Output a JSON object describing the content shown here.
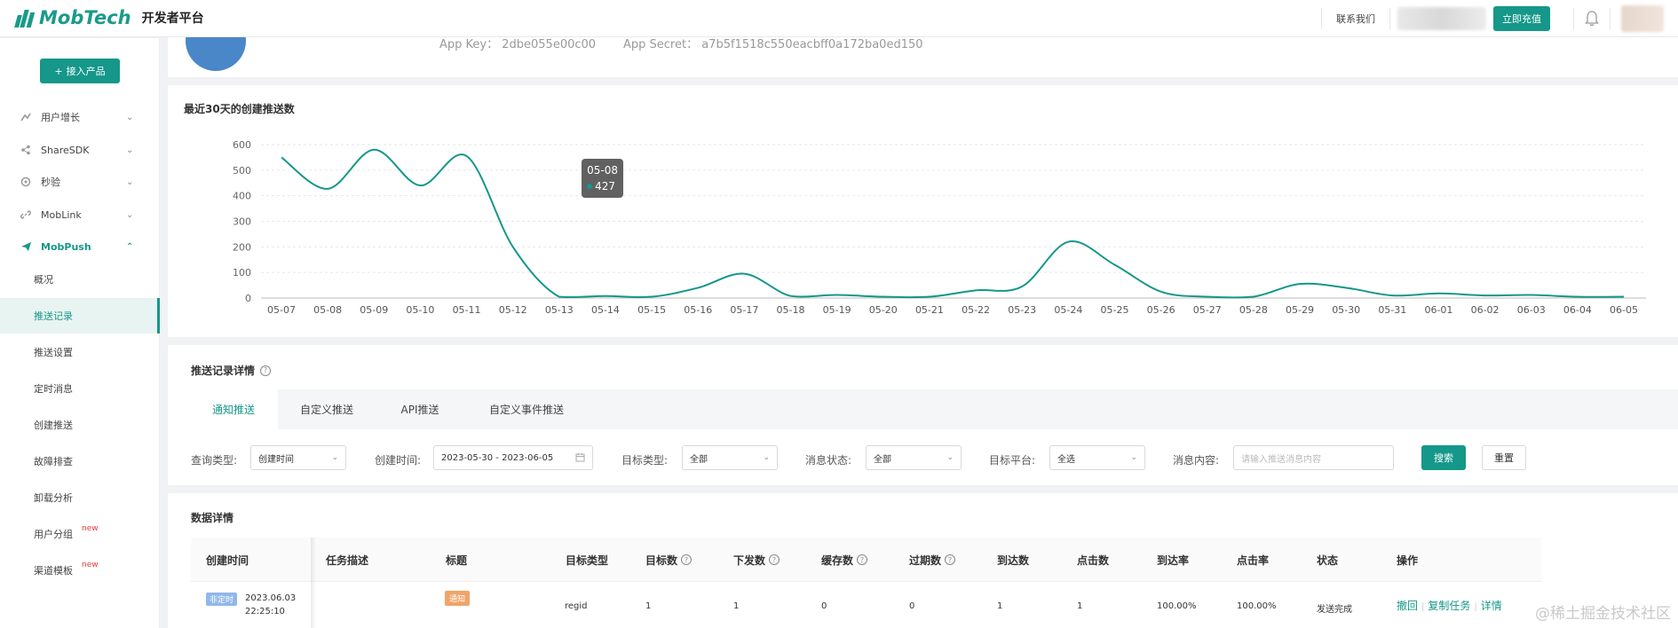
{
  "brand": {
    "logo": "MobTech",
    "subtitle": "开发者平台",
    "accent": "#15978a"
  },
  "top": {
    "contact": "联系我们",
    "recharge": "立即充值",
    "bell_icon": "bell-icon"
  },
  "sidebar": {
    "add_product": "接入产品",
    "groups": [
      {
        "label": "用户增长",
        "icon": "growth-icon"
      },
      {
        "label": "ShareSDK",
        "icon": "share-icon"
      },
      {
        "label": "秒验",
        "icon": "verify-icon"
      },
      {
        "label": "MobLink",
        "icon": "link-icon"
      },
      {
        "label": "MobPush",
        "icon": "send-icon"
      }
    ],
    "subitems": [
      {
        "label": "概况"
      },
      {
        "label": "推送记录"
      },
      {
        "label": "推送设置"
      },
      {
        "label": "定时消息"
      },
      {
        "label": "创建推送"
      },
      {
        "label": "故障排查"
      },
      {
        "label": "卸载分析"
      },
      {
        "label": "用户分组",
        "tag": "new"
      },
      {
        "label": "渠道模板",
        "tag": "new"
      }
    ]
  },
  "app": {
    "key_label": "App Key： 2dbe055e00c00",
    "secret_label": "App Secret： a7b5f1518c550eacbff0a172ba0ed150"
  },
  "chart_data": {
    "type": "line",
    "title": "最近30天的创建推送数",
    "categories": [
      "05-07",
      "05-08",
      "05-09",
      "05-10",
      "05-11",
      "05-12",
      "05-13",
      "05-14",
      "05-15",
      "05-16",
      "05-17",
      "05-18",
      "05-19",
      "05-20",
      "05-21",
      "05-22",
      "05-23",
      "05-24",
      "05-25",
      "05-26",
      "05-27",
      "05-28",
      "05-29",
      "05-30",
      "05-31",
      "06-01",
      "06-02",
      "06-03",
      "06-04",
      "06-05"
    ],
    "values": [
      550,
      427,
      580,
      440,
      555,
      200,
      5,
      8,
      5,
      40,
      95,
      8,
      12,
      5,
      5,
      30,
      45,
      220,
      130,
      25,
      5,
      5,
      55,
      40,
      10,
      18,
      10,
      12,
      5,
      5
    ],
    "yticks": [
      "0",
      "100",
      "200",
      "300",
      "400",
      "500",
      "600"
    ],
    "ylim": [
      0,
      600
    ],
    "grid": true,
    "tooltip": {
      "label": "05-08",
      "value": "427"
    },
    "line_color": "#15978a"
  },
  "detail": {
    "title": "推送记录详情",
    "tabs": [
      {
        "label": "通知推送"
      },
      {
        "label": "自定义推送"
      },
      {
        "label": "API推送"
      },
      {
        "label": "自定义事件推送"
      }
    ],
    "filters": {
      "query_type_label": "查询类型:",
      "query_type_value": "创建时间",
      "created_label": "创建时间:",
      "created_value": "2023-05-30 - 2023-06-05",
      "target_type_label": "目标类型:",
      "target_type_value": "全部",
      "msg_status_label": "消息状态:",
      "msg_status_value": "全部",
      "platform_label": "目标平台:",
      "platform_value": "全选",
      "content_label": "消息内容:",
      "content_placeholder": "请输入推送消息内容",
      "search": "搜索",
      "reset": "重置"
    }
  },
  "table": {
    "title": "数据详情",
    "headers": [
      "创建时间",
      "任务描述",
      "标题",
      "目标类型",
      "目标数",
      "下发数",
      "缓存数",
      "过期数",
      "到达数",
      "点击数",
      "到达率",
      "点击率",
      "状态",
      "操作"
    ],
    "row": {
      "badge": "非定时",
      "date": "2023.06.03",
      "time": "22:25:10",
      "desc": "",
      "title_tag": "通知",
      "target_type": "regid",
      "target": "1",
      "sent": "1",
      "cache": "0",
      "expired": "0",
      "arrived": "1",
      "clicked": "1",
      "arrive_rate": "100.00%",
      "click_rate": "100.00%",
      "status": "发送完成",
      "ops": [
        "撤回",
        "复制任务",
        "详情"
      ]
    }
  },
  "watermark": "@稀土掘金技术社区"
}
